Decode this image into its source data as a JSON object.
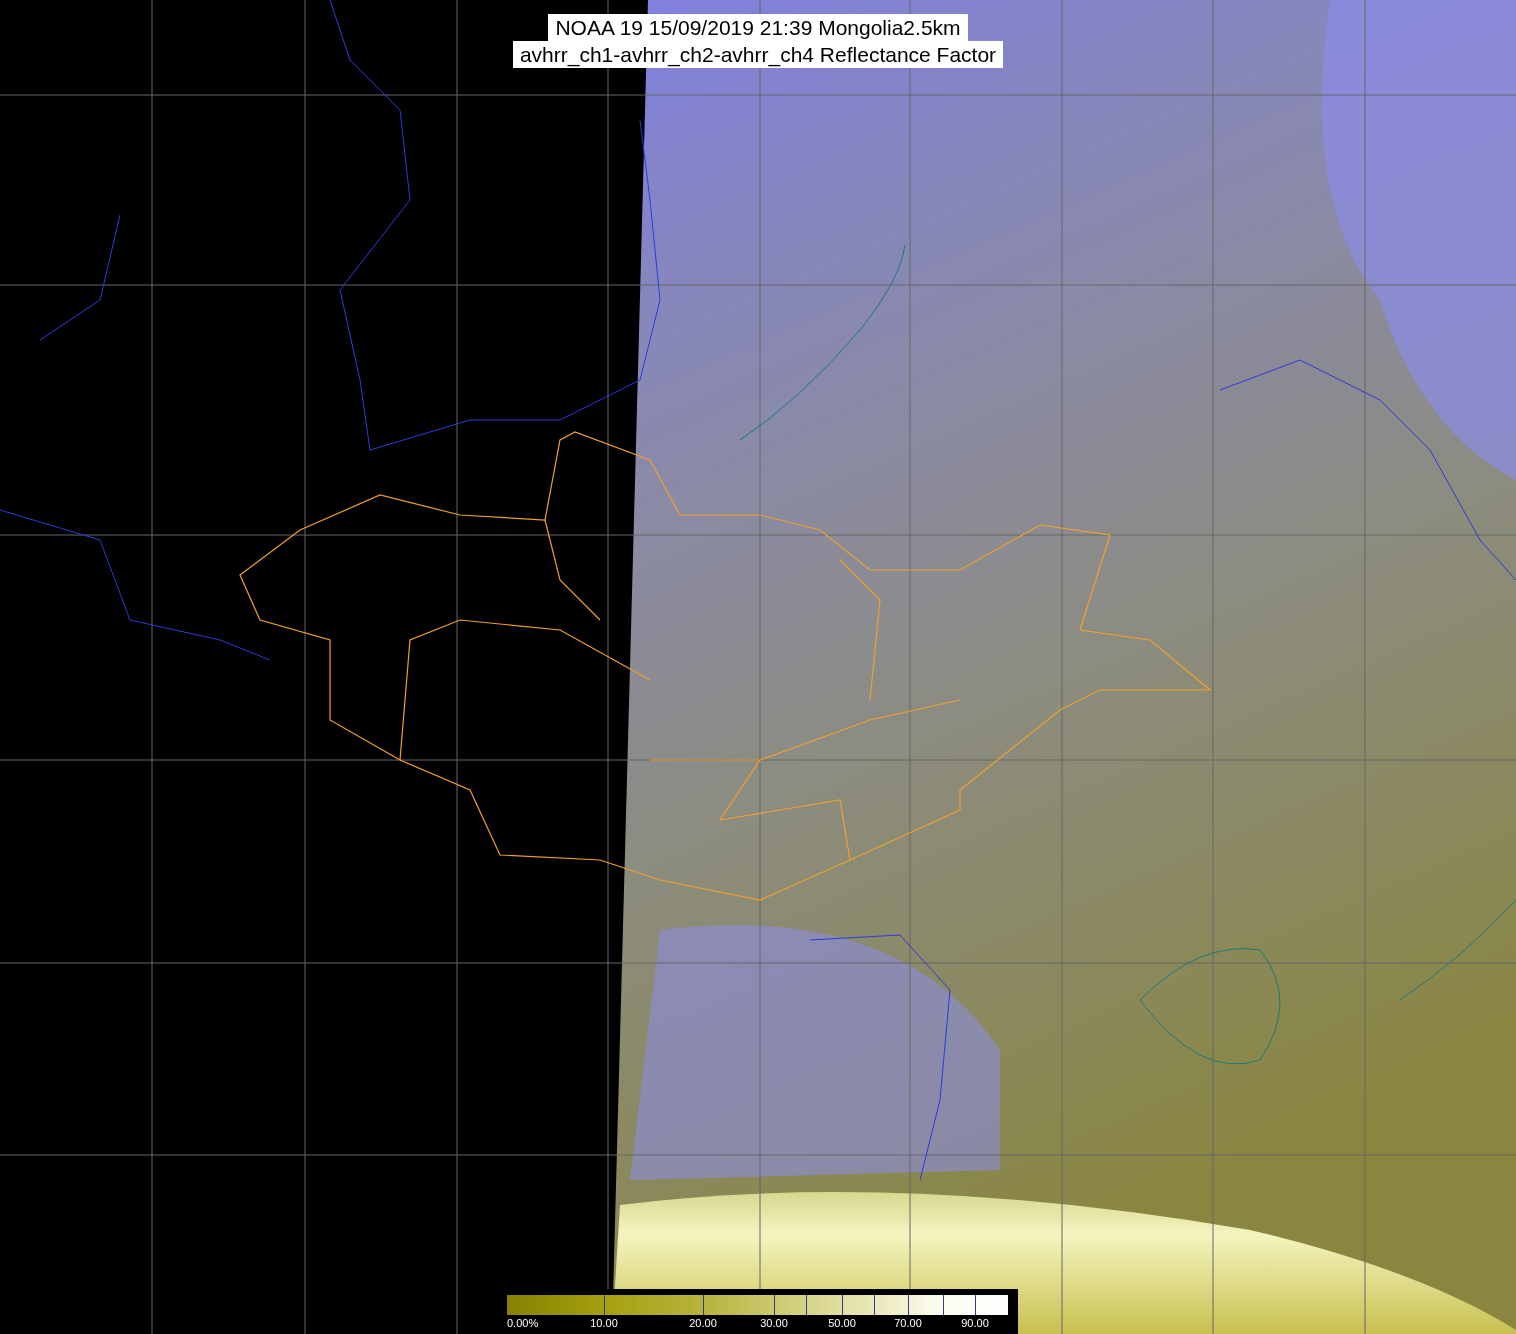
{
  "title_lines": [
    "NOAA 19 15/09/2019 21:39 Mongolia2.5km",
    "avhrr_ch1-avhrr_ch2-avhrr_ch4 Reflectance Factor"
  ],
  "colorbar": {
    "labels": [
      "0.00%",
      "10.00",
      "20.00",
      "30.00",
      "50.00",
      "70.00",
      "90.00"
    ]
  }
}
